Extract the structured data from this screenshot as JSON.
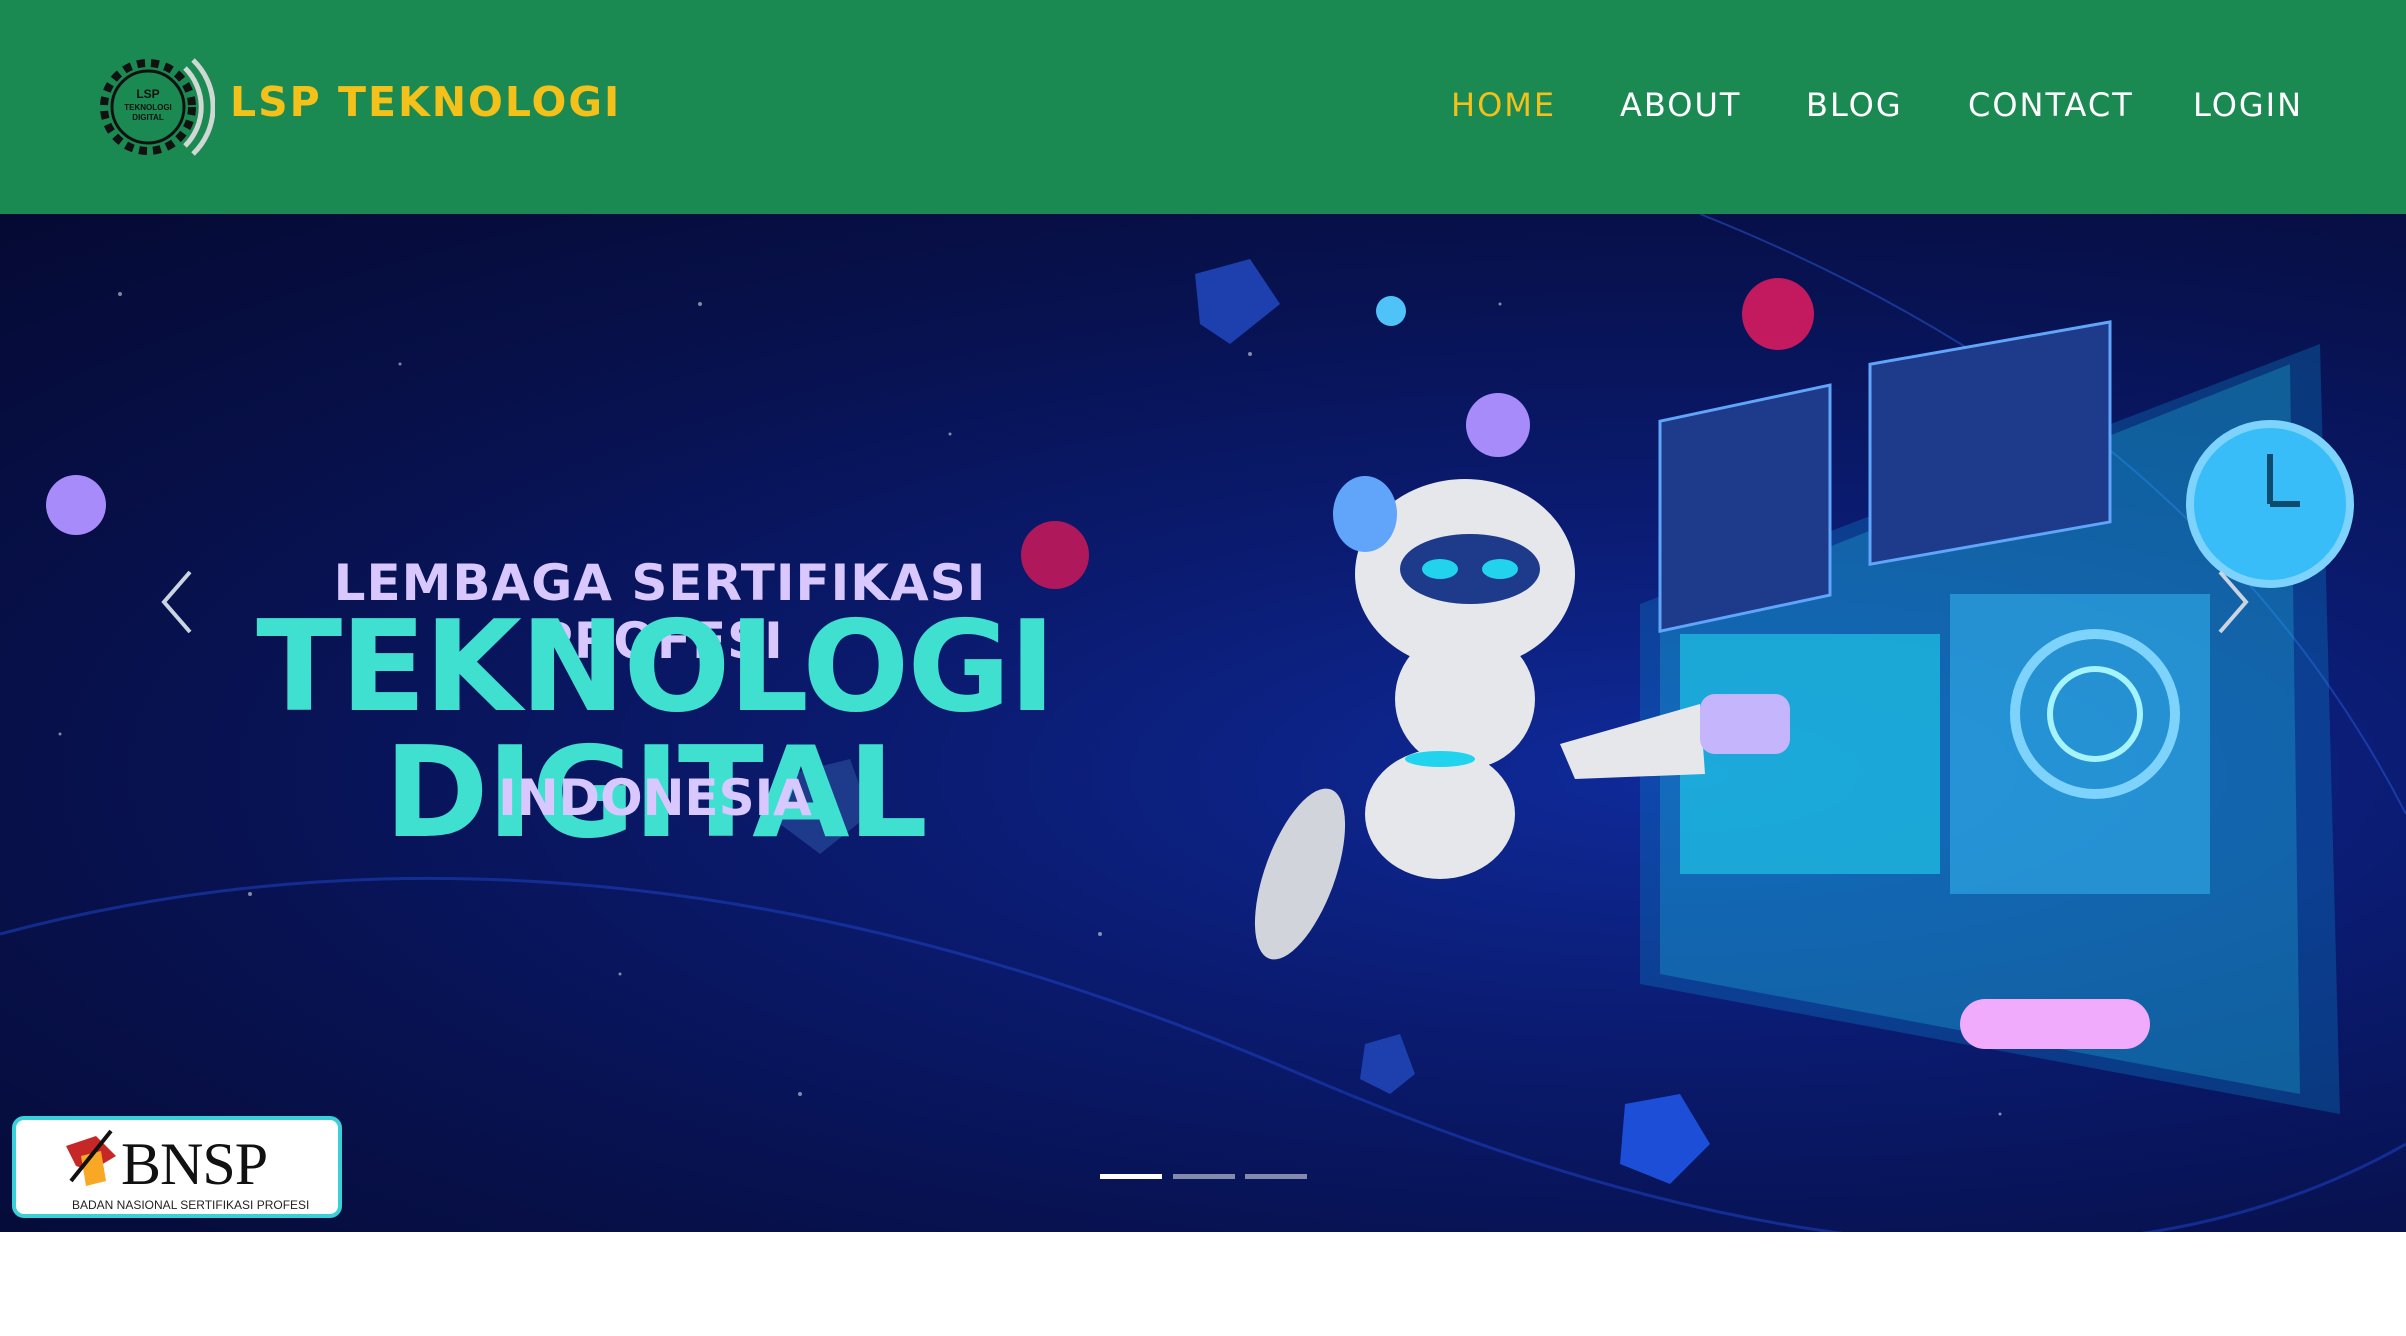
{
  "header": {
    "brand": "LSP TEKNOLOGI",
    "logo_text": [
      "LSP",
      "TEKNOLOGI",
      "DIGITAL"
    ],
    "nav": [
      {
        "label": "HOME",
        "active": true
      },
      {
        "label": "ABOUT",
        "active": false
      },
      {
        "label": "BLOG",
        "active": false
      },
      {
        "label": "CONTACT",
        "active": false
      },
      {
        "label": "LOGIN",
        "active": false
      }
    ]
  },
  "hero": {
    "line1": "LEMBAGA SERTIFIKASI PROFESI",
    "line2": "TEKNOLOGI DIGITAL",
    "line3": "INDONESIA",
    "prev_icon": "chevron-left-icon",
    "next_icon": "chevron-right-icon",
    "slides_total": 3,
    "active_slide": 1
  },
  "badge": {
    "name": "BNSP",
    "subtitle": "BADAN NASIONAL SERTIFIKASI PROFESI"
  },
  "colors": {
    "header_bg": "#1b8a52",
    "brand": "#f3c11a",
    "nav_active": "#f3c11a",
    "nav_text": "#ffffff",
    "hero_title": "#40e0d0",
    "hero_sub": "#d8c8ff",
    "hero_bg": "#0a1a6e"
  }
}
